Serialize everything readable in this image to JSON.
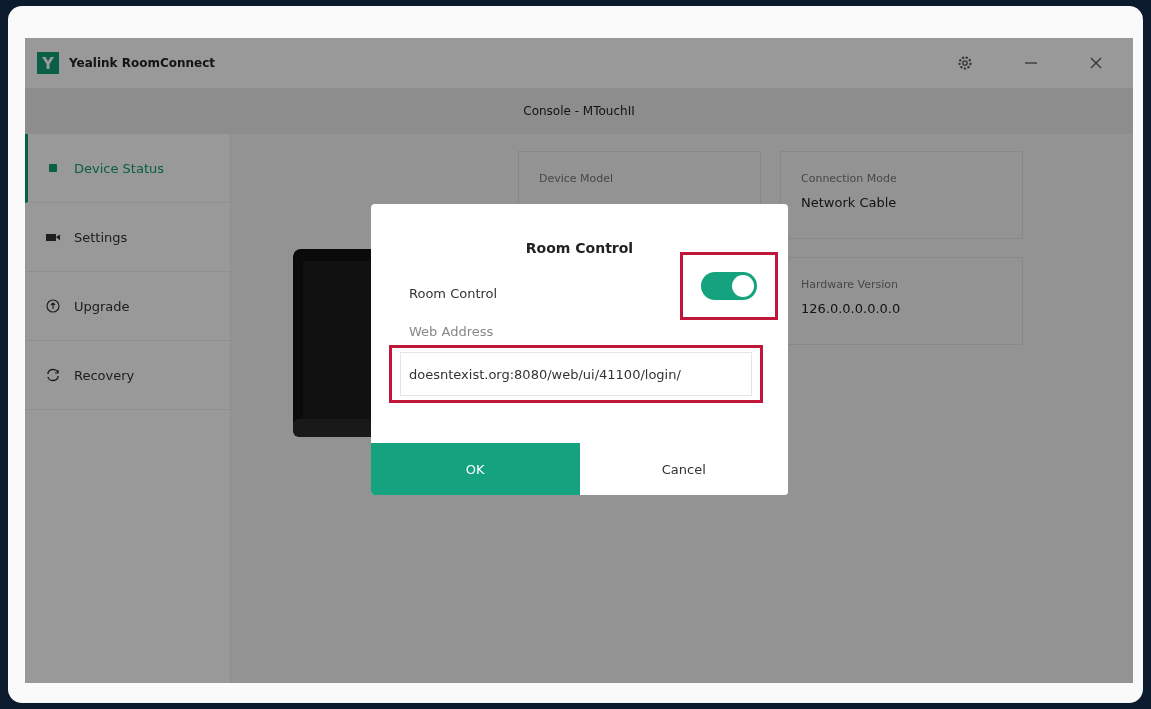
{
  "window": {
    "title": "Yealink RoomConnect",
    "logo": "Y"
  },
  "header": {
    "title": "Console - MTouchII"
  },
  "sidebar": {
    "items": [
      {
        "label": "Device Status",
        "kind": "status",
        "selected": true
      },
      {
        "label": "Settings",
        "kind": "settings",
        "selected": false
      },
      {
        "label": "Upgrade",
        "kind": "upgrade",
        "selected": false
      },
      {
        "label": "Recovery",
        "kind": "recovery",
        "selected": false
      }
    ]
  },
  "cards": [
    {
      "label": "Device Model"
    },
    {
      "label": "Connection Mode",
      "value": "Network Cable"
    },
    {
      "label": "Hardware Version",
      "value": "126.0.0.0.0.0.0"
    }
  ],
  "dialog": {
    "title": "Room Control",
    "toggle": {
      "label": "Room Control",
      "on": true,
      "highlighted": true
    },
    "field": {
      "label": "Web Address",
      "value": "doesntexist.org:8080/web/ui/41100/login/",
      "highlighted": true
    },
    "buttons": [
      {
        "label": "OK",
        "kind": "primary"
      },
      {
        "label": "Cancel",
        "kind": "secondary"
      }
    ]
  }
}
